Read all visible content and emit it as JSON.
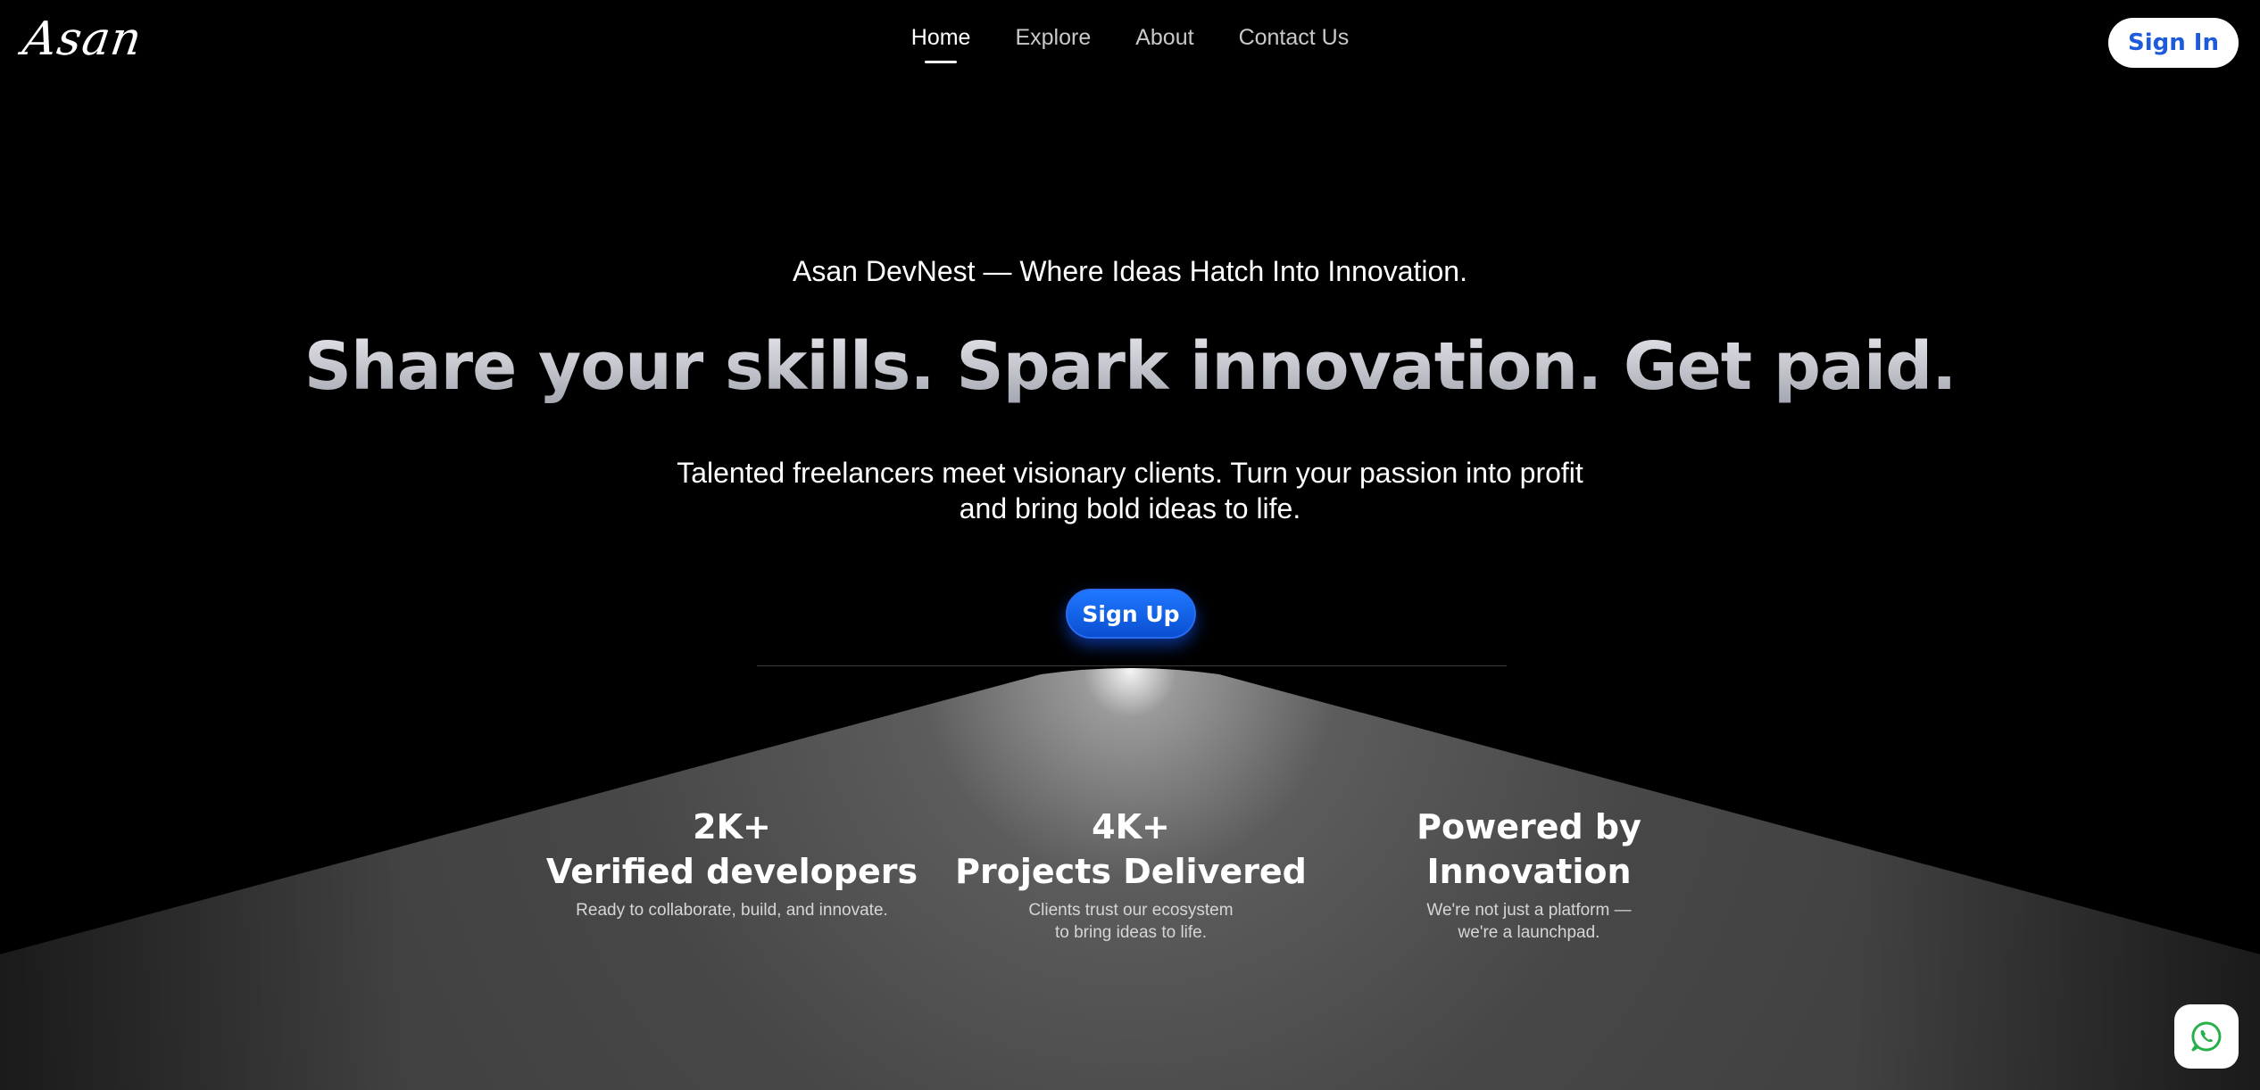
{
  "brand": {
    "logo_text": "Asan"
  },
  "nav": {
    "items": [
      {
        "label": "Home",
        "active": true
      },
      {
        "label": "Explore",
        "active": false
      },
      {
        "label": "About",
        "active": false
      },
      {
        "label": "Contact Us",
        "active": false
      }
    ]
  },
  "header": {
    "signin_label": "Sign In"
  },
  "hero": {
    "tagline": "Asan DevNest — Where Ideas Hatch Into Innovation.",
    "headline": "Share your skills. Spark innovation. Get paid.",
    "subtext_line1": "Talented freelancers meet visionary clients. Turn your passion into profit",
    "subtext_line2": "and bring bold ideas to life.",
    "signup_label": "Sign Up"
  },
  "stats": [
    {
      "value": "2K+",
      "label": "Verified developers",
      "desc": "Ready to collaborate, build, and innovate."
    },
    {
      "value": "4K+",
      "label": "Projects Delivered",
      "desc": "Clients trust our ecosystem\nto bring ideas to life."
    },
    {
      "value": "Powered by",
      "label": "Innovation",
      "desc": "We're not just a platform —\nwe're a launchpad."
    }
  ],
  "floating": {
    "icon": "whatsapp-icon"
  },
  "colors": {
    "background": "#000000",
    "accent_blue": "#1d5bdb",
    "signup_blue": "#1f78ff",
    "whatsapp_green": "#25b04a"
  }
}
